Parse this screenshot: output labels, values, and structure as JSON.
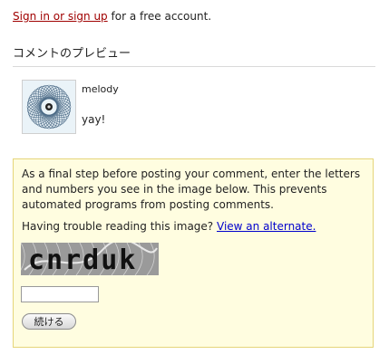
{
  "signin": {
    "link_text": "Sign in or sign up",
    "suffix_text": "for a free account."
  },
  "preview": {
    "title": "コメントのプレビュー",
    "avatar_icon": "spirograph-avatar-icon",
    "author": "melody",
    "body": "yay!"
  },
  "captcha": {
    "message": "As a final step before posting your comment, enter the letters and numbers you see in the image below. This prevents automated programs from posting comments.",
    "trouble_text": "Having trouble reading this image?",
    "alternate_link": "View an alternate.",
    "image_text": "cnrduk",
    "input_value": "",
    "input_placeholder": "",
    "continue_label": "続ける"
  },
  "colors": {
    "signin_link": "#a00000",
    "alternate_link": "#0000cc",
    "captcha_box_bg": "#fffde0",
    "captcha_box_border": "#e5d57a"
  }
}
